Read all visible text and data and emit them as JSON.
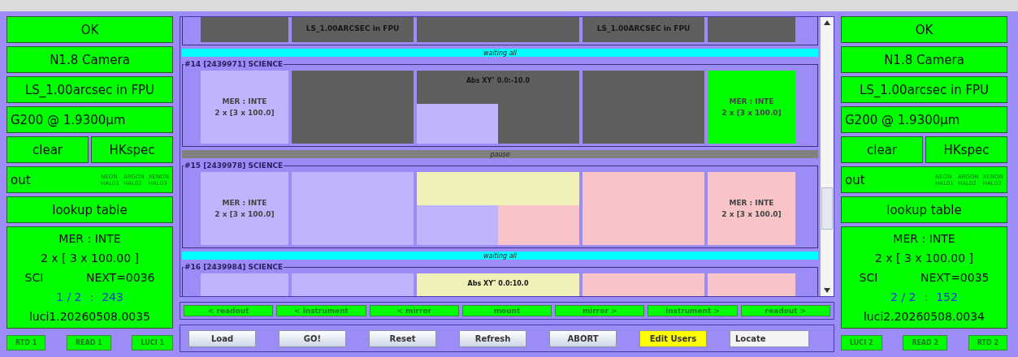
{
  "left_panel": {
    "status": "OK",
    "camera": "N1.8 Camera",
    "mask": "LS_1.00arcsec in FPU",
    "grating": "G200 @ 1.9300µm",
    "filters": [
      "clear",
      "HKspec"
    ],
    "calibration": {
      "unit": "out",
      "lamps": [
        {
          "label": "NEON",
          "on": false
        },
        {
          "label": "ARGON",
          "on": false
        },
        {
          "label": "XENON",
          "on": false
        },
        {
          "label": "HAL01",
          "on": false
        },
        {
          "label": "HAL02",
          "on": false
        },
        {
          "label": "HAL03",
          "on": false
        }
      ]
    },
    "focus": "lookup table",
    "exposure": {
      "mode": "MER : INTE",
      "repeat": "2 x [ 3 x 100.00 ]",
      "type": "SCI",
      "next": "NEXT=0036",
      "count": "1 / 2",
      "separator": ":",
      "value": "243",
      "file": "luci1.20260508.0035"
    },
    "buttons": [
      "RTD 1",
      "READ 1",
      "LUCI 1"
    ]
  },
  "sequence": [
    {
      "kind": "block",
      "clipped_top": true,
      "cells": [
        {
          "kind": "plain",
          "color": "#5f5f5f"
        },
        {
          "kind": "plain",
          "color": "#5f5f5f",
          "lines": [
            "LS_1.00ARCSEC in FPU"
          ]
        },
        {
          "kind": "plain",
          "color": "#5f5f5f"
        },
        {
          "kind": "plain",
          "color": "#5f5f5f",
          "lines": [
            "LS_1.00ARCSEC in FPU"
          ]
        },
        {
          "kind": "plain",
          "color": "#5f5f5f"
        }
      ]
    },
    {
      "kind": "status",
      "text": "waiting all",
      "color": "#00ffff"
    },
    {
      "kind": "block",
      "clipped_top": false,
      "title": "#14 [2439971] SCIENCE",
      "cells": [
        {
          "kind": "plain",
          "color": "#c0b4ff",
          "lines": [
            "MER : INTE",
            "2 x [3 x 100.0]"
          ]
        },
        {
          "kind": "plain",
          "color": "#5f5f5f"
        },
        {
          "kind": "split",
          "text": "Abs XY″ 0.0:-10.0",
          "parts": [
            {
              "color": "#5f5f5f"
            },
            {
              "color": "#c0b4ff"
            },
            {
              "color": "#5f5f5f"
            }
          ]
        },
        {
          "kind": "plain",
          "color": "#5f5f5f"
        },
        {
          "kind": "plain",
          "color": "#00ff00",
          "lines": [
            "MER : INTE",
            "2 x [3 x 100.0]"
          ]
        }
      ]
    },
    {
      "kind": "status",
      "text": "pause",
      "color": "#808080"
    },
    {
      "kind": "block",
      "clipped_top": false,
      "title": "#15 [2439978] SCIENCE",
      "cells": [
        {
          "kind": "plain",
          "color": "#c0b4ff",
          "lines": [
            "MER : INTE",
            "2 x [3 x 100.0]"
          ]
        },
        {
          "kind": "plain",
          "color": "#c0b4ff"
        },
        {
          "kind": "split",
          "parts": [
            {
              "color": "#f0f0b8"
            },
            {
              "color": "#c0b4ff"
            },
            {
              "color": "#f8c4c8"
            }
          ]
        },
        {
          "kind": "plain",
          "color": "#f8c4c8"
        },
        {
          "kind": "plain",
          "color": "#f8c4c8",
          "lines": [
            "MER : INTE",
            "2 x [3 x 100.0]"
          ]
        }
      ]
    },
    {
      "kind": "status",
      "text": "waiting all",
      "color": "#00ffff"
    },
    {
      "kind": "block",
      "clipped_top": false,
      "title": "#16 [2439984] SCIENCE",
      "cells": [
        {
          "kind": "plain",
          "color": "#c0b4ff"
        },
        {
          "kind": "plain",
          "color": "#c0b4ff"
        },
        {
          "kind": "split",
          "text": "Abs XY″ 0.0:10.0",
          "parts": [
            {
              "color": "#f0f0b8"
            }
          ]
        },
        {
          "kind": "plain",
          "color": "#f8c4c8"
        },
        {
          "kind": "plain",
          "color": "#f8c4c8"
        }
      ]
    }
  ],
  "navigation": [
    "< readout",
    "< instrument",
    "< mirror",
    "mount",
    "mirror >",
    "instrument >",
    "readout >"
  ],
  "actions": [
    {
      "label": "Load",
      "kind": "normal"
    },
    {
      "label": "GO!",
      "kind": "normal"
    },
    {
      "label": "Reset",
      "kind": "normal"
    },
    {
      "label": "Refresh",
      "kind": "normal"
    },
    {
      "label": "ABORT",
      "kind": "normal"
    },
    {
      "label": "Edit Users",
      "kind": "highlight"
    },
    {
      "label": "Locate",
      "kind": "flat"
    }
  ],
  "right_panel": {
    "status": "OK",
    "camera": "N1.8 Camera",
    "mask": "LS_1.00arcsec in FPU",
    "grating": "G200 @ 1.9300µm",
    "filters": [
      "clear",
      "HKspec"
    ],
    "calibration": {
      "unit": "out",
      "lamps": [
        {
          "label": "NEON",
          "on": false
        },
        {
          "label": "ARGON",
          "on": false
        },
        {
          "label": "XENON",
          "on": false
        },
        {
          "label": "HAL01",
          "on": false
        },
        {
          "label": "HAL02",
          "on": false
        },
        {
          "label": "HAL03",
          "on": false
        }
      ]
    },
    "focus": "lookup table",
    "exposure": {
      "mode": "MER : INTE",
      "repeat": "2 x [ 3 x 100.00 ]",
      "type": "SCI",
      "next": "NEXT=0035",
      "count": "2 / 2",
      "separator": ":",
      "value": "152",
      "file": "luci2.20260508.0034"
    },
    "buttons": [
      "LUCI 2",
      "READ 2",
      "RTD 2"
    ]
  }
}
